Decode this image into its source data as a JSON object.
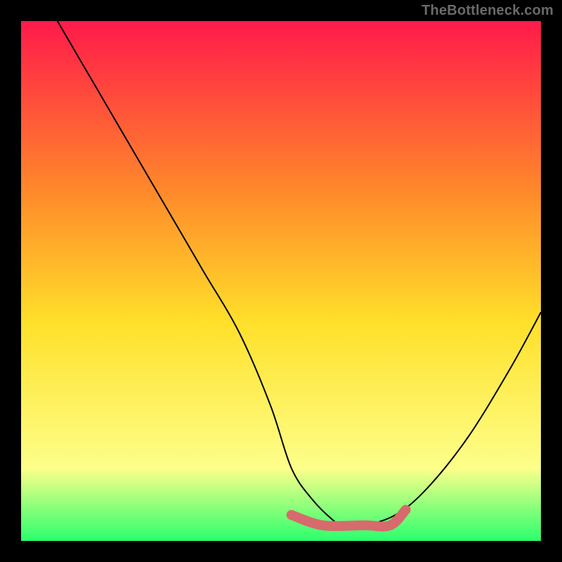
{
  "watermark": "TheBottleneck.com",
  "colors": {
    "bg_black": "#000000",
    "grad_top": "#ff1a4a",
    "grad_mid1": "#ff8a2a",
    "grad_mid2": "#ffe02a",
    "grad_low": "#fdff8a",
    "grad_bottom": "#2aff6d",
    "curve": "#000000",
    "bump": "#d76a6d"
  },
  "chart_data": {
    "type": "line",
    "title": "",
    "xlabel": "",
    "ylabel": "",
    "xlim": [
      0,
      100
    ],
    "ylim": [
      0,
      100
    ],
    "series": [
      {
        "name": "V-curve",
        "x": [
          7,
          14,
          21,
          28,
          35,
          42,
          48,
          52,
          56,
          60,
          62,
          66,
          72,
          78,
          86,
          94,
          100
        ],
        "y": [
          100,
          88,
          76,
          64,
          52,
          40,
          26,
          14,
          8,
          4,
          3,
          3,
          5,
          10,
          20,
          33,
          44
        ]
      },
      {
        "name": "flat-bottom-highlight",
        "x": [
          52,
          58,
          66,
          71,
          74
        ],
        "y": [
          5,
          3,
          3,
          3,
          6
        ]
      }
    ],
    "annotations": []
  }
}
